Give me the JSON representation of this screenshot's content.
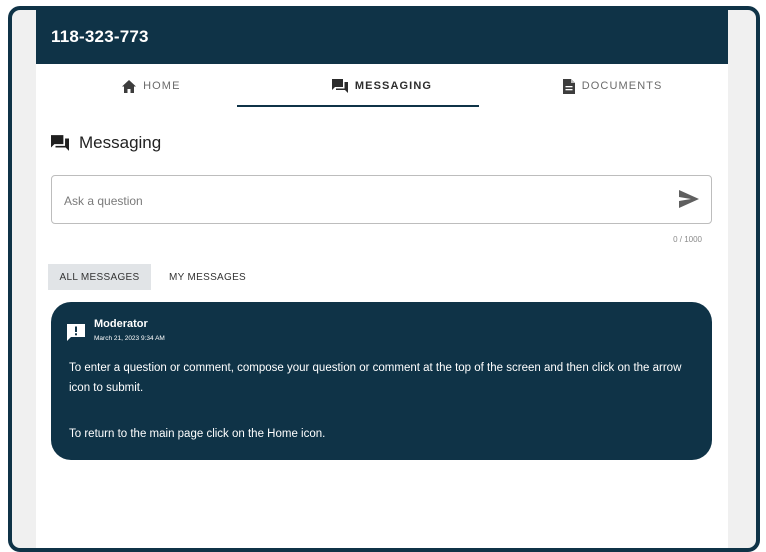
{
  "header": {
    "title": "118-323-773"
  },
  "tabs": [
    {
      "label": "HOME",
      "icon": "home-icon"
    },
    {
      "label": "MESSAGING",
      "icon": "messaging-icon"
    },
    {
      "label": "DOCUMENTS",
      "icon": "document-icon"
    }
  ],
  "section": {
    "title": "Messaging"
  },
  "ask": {
    "placeholder": "Ask a question",
    "value": "",
    "counter": "0 / 1000"
  },
  "filters": {
    "all": "ALL MESSAGES",
    "mine": "MY MESSAGES"
  },
  "message": {
    "author": "Moderator",
    "date": "March 21, 2023 9:34 AM",
    "text1": "To enter a question or comment, compose your question or comment at the top of the screen and then click on the arrow icon to submit.",
    "text2": "To return to the main page click on the Home icon."
  },
  "colors": {
    "brand": "#0f3347",
    "active_filter_bg": "#e1e4e7"
  }
}
